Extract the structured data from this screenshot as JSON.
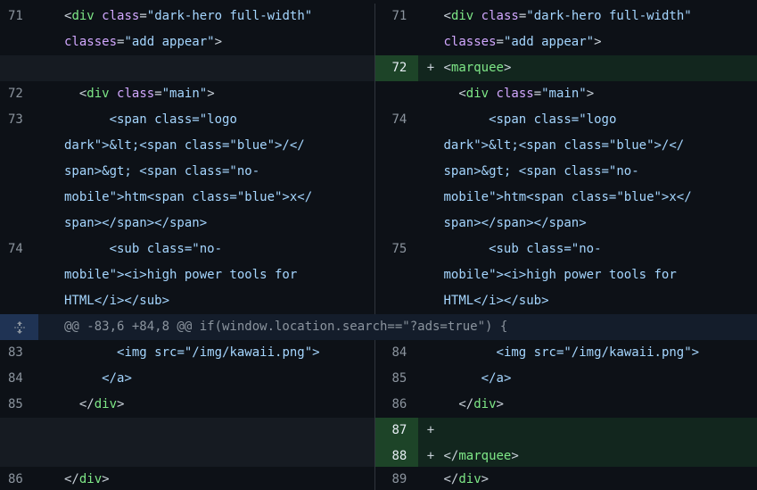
{
  "colors": {
    "background": "#0d1117",
    "tag": "#7ee787",
    "attribute": "#d2a8ff",
    "string": "#a5d6ff",
    "added_line_bg": "#12261e",
    "added_number_bg": "#1d4428",
    "hunk_bg": "#141d2b"
  },
  "hunk": {
    "expand_icon": "unfold-icon",
    "header": "@@ -83,6 +84,8 @@ if(window.location.search==\"?ads=true\") {"
  },
  "left": {
    "ln_71": "71",
    "ln_72": "72",
    "ln_73": "73",
    "ln_74": "74",
    "ln_83": "83",
    "ln_84": "84",
    "ln_85": "85",
    "ln_86": "86"
  },
  "right": {
    "ln_71": "71",
    "ln_72": "72",
    "ln_74": "74",
    "ln_75": "75",
    "ln_84": "84",
    "ln_85": "85",
    "ln_86": "86",
    "ln_87": "87",
    "ln_88": "88",
    "ln_89": "89",
    "added_marker": "+"
  },
  "code": {
    "lt": "<",
    "gt": ">",
    "lt_slash": "</",
    "div": "div",
    "span": "span",
    "sub": "sub",
    "img": "img",
    "a_tag": "a",
    "marquee": "marquee",
    "class_attr": "class",
    "src_attr": "src",
    "classes_attr": "classes",
    "eq": "=",
    "hero_val": "\"dark-hero full-width\"",
    "classes_val": "\"add appear\"",
    "main_val": "\"main\"",
    "logo_val_open": "\"logo",
    "logo_val_close": "dark\"",
    "blue_val": "\"blue\"",
    "nomobile_open": "\"no-",
    "nomobile_close": "mobile\"",
    "kawaii_val": "\"/img/kawaii.png\"",
    "gt_lt_entity": ">&lt;",
    "close_span_gt": "></",
    "span_gt_entity": "span>&gt; ",
    "htm": "htm",
    "x_text": "x</",
    "span_close_chain": "span></span></span>",
    "i_open": "<i>high power tools for",
    "html_close_i": "HTML</i></sub>"
  }
}
